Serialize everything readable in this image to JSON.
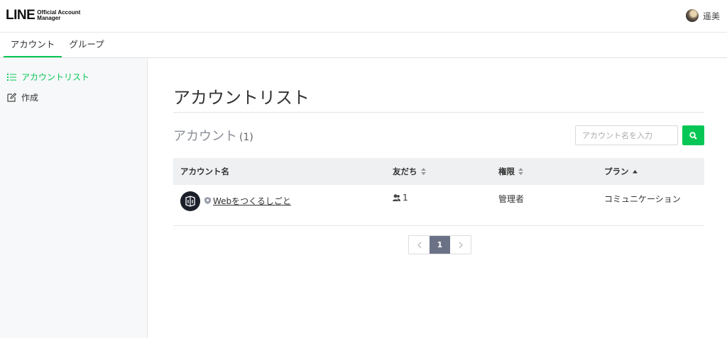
{
  "header": {
    "logo_main": "LINE",
    "logo_sub_line1": "Official Account",
    "logo_sub_line2": "Manager",
    "user_name": "遥美"
  },
  "tabs": [
    {
      "label": "アカウント",
      "active": true
    },
    {
      "label": "グループ",
      "active": false
    }
  ],
  "sidebar": {
    "items": [
      {
        "label": "アカウントリスト",
        "icon": "list-icon",
        "active": true
      },
      {
        "label": "作成",
        "icon": "edit-icon",
        "active": false
      }
    ]
  },
  "main": {
    "page_title": "アカウントリスト",
    "section_title": "アカウント",
    "section_count": "(1)",
    "search_placeholder": "アカウント名を入力",
    "table": {
      "columns": [
        {
          "label": "アカウント名",
          "sort": "none"
        },
        {
          "label": "友だち",
          "sort": "both"
        },
        {
          "label": "権限",
          "sort": "both"
        },
        {
          "label": "プラン",
          "sort": "asc"
        }
      ],
      "rows": [
        {
          "name": "Webをつくるしごと",
          "friends": "1",
          "role": "管理者",
          "plan": "コミュニケーション"
        }
      ]
    },
    "pagination": {
      "current": "1",
      "prev_icon": "chevron-left-icon",
      "next_icon": "chevron-right-icon"
    }
  },
  "colors": {
    "accent": "#06c755",
    "pager_active": "#6b7286",
    "header_bg": "#eef0f2"
  }
}
